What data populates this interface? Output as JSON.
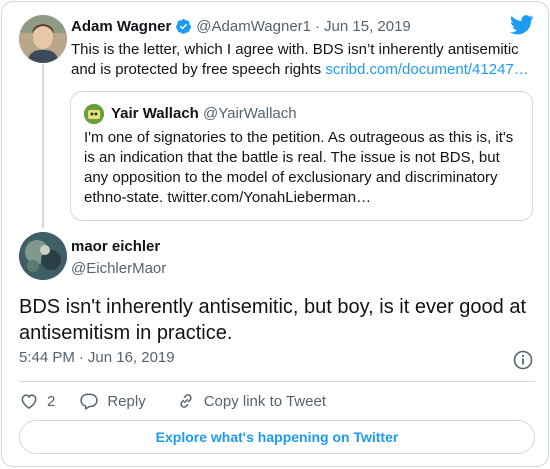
{
  "parent_tweet": {
    "author_name": "Adam Wagner",
    "author_handle": "@AdamWagner1",
    "date": "Jun 15, 2019",
    "separator": "·",
    "text": "This is the letter, which I agree with. BDS isn’t inherently antisemitic and is protected by free speech rights",
    "link_text": "scribd.com/document/41247…"
  },
  "quoted_tweet": {
    "author_name": "Yair Wallach",
    "author_handle": "@YairWallach",
    "text": "I'm one of signatories to the petition. As outrageous as this is, it's is an indication that the battle is real. The issue is not BDS, but any opposition to the  model of exclusionary and discriminatory ethno-state. twitter.com/YonahLieberman…"
  },
  "main_tweet": {
    "author_name": "maor eichler",
    "author_handle": "@EichlerMaor",
    "text": "BDS isn't inherently antisemitic, but boy, is it ever good at antisemitism in practice.",
    "time": "5:44 PM",
    "separator": "·",
    "date": "Jun 16, 2019"
  },
  "actions": {
    "like_count": "2",
    "reply_label": "Reply",
    "copy_link_label": "Copy link to Tweet"
  },
  "footer": {
    "explore_label": "Explore what's happening on Twitter"
  },
  "colors": {
    "accent": "#1d9bf0",
    "text": "#0f1419",
    "muted": "#536471",
    "border": "#cfd9de"
  },
  "icons": [
    "twitter-bird-icon",
    "verified-badge-icon",
    "info-icon",
    "heart-icon",
    "reply-icon",
    "link-icon"
  ]
}
